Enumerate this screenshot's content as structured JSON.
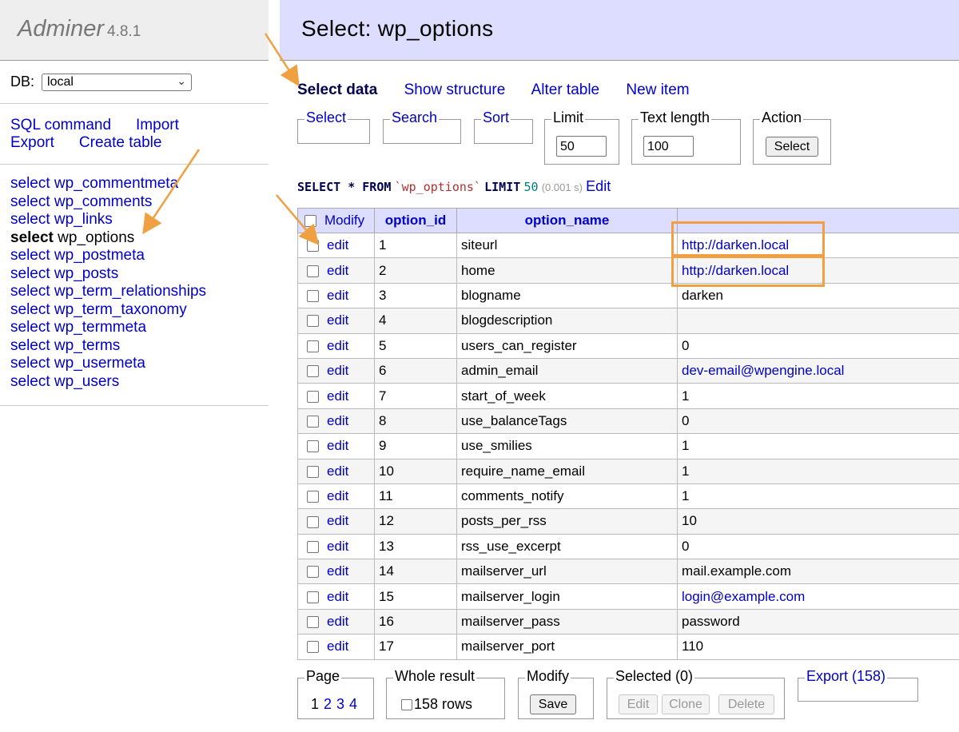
{
  "brand": {
    "name": "Adminer",
    "version": "4.8.1"
  },
  "db": {
    "label": "DB:",
    "value": "local"
  },
  "commands": {
    "sql": "SQL command",
    "import": "Import",
    "export": "Export",
    "create": "Create table"
  },
  "tables": [
    {
      "kw": "select",
      "name": "wp_commentmeta"
    },
    {
      "kw": "select",
      "name": "wp_comments"
    },
    {
      "kw": "select",
      "name": "wp_links"
    },
    {
      "kw": "select",
      "name": "wp_options",
      "active": true
    },
    {
      "kw": "select",
      "name": "wp_postmeta"
    },
    {
      "kw": "select",
      "name": "wp_posts"
    },
    {
      "kw": "select",
      "name": "wp_term_relationships"
    },
    {
      "kw": "select",
      "name": "wp_term_taxonomy"
    },
    {
      "kw": "select",
      "name": "wp_termmeta"
    },
    {
      "kw": "select",
      "name": "wp_terms"
    },
    {
      "kw": "select",
      "name": "wp_usermeta"
    },
    {
      "kw": "select",
      "name": "wp_users"
    }
  ],
  "header": {
    "title": "Select: wp_options"
  },
  "tabs": {
    "select_data": "Select data",
    "show_structure": "Show structure",
    "alter_table": "Alter table",
    "new_item": "New item"
  },
  "filters": {
    "select": "Select",
    "search": "Search",
    "sort": "Sort",
    "limit_label": "Limit",
    "limit_value": "50",
    "textlen_label": "Text length",
    "textlen_value": "100",
    "action_label": "Action",
    "action_button": "Select"
  },
  "query": {
    "part1": "SELECT * FROM",
    "table": "`wp_options`",
    "part2": "LIMIT",
    "limit": "50",
    "time": "(0.001 s)",
    "edit": "Edit"
  },
  "grid": {
    "headers": {
      "modify": "Modify",
      "option_id": "option_id",
      "option_name": "option_name",
      "option_value": ""
    },
    "edit_label": "edit",
    "rows": [
      {
        "id": "1",
        "name": "siteurl",
        "value": "http://darken.local",
        "link": true
      },
      {
        "id": "2",
        "name": "home",
        "value": "http://darken.local",
        "link": true
      },
      {
        "id": "3",
        "name": "blogname",
        "value": "darken"
      },
      {
        "id": "4",
        "name": "blogdescription",
        "value": ""
      },
      {
        "id": "5",
        "name": "users_can_register",
        "value": "0"
      },
      {
        "id": "6",
        "name": "admin_email",
        "value": "dev-email@wpengine.local",
        "link": true
      },
      {
        "id": "7",
        "name": "start_of_week",
        "value": "1"
      },
      {
        "id": "8",
        "name": "use_balanceTags",
        "value": "0"
      },
      {
        "id": "9",
        "name": "use_smilies",
        "value": "1"
      },
      {
        "id": "10",
        "name": "require_name_email",
        "value": "1"
      },
      {
        "id": "11",
        "name": "comments_notify",
        "value": "1"
      },
      {
        "id": "12",
        "name": "posts_per_rss",
        "value": "10"
      },
      {
        "id": "13",
        "name": "rss_use_excerpt",
        "value": "0"
      },
      {
        "id": "14",
        "name": "mailserver_url",
        "value": "mail.example.com"
      },
      {
        "id": "15",
        "name": "mailserver_login",
        "value": "login@example.com",
        "link": true
      },
      {
        "id": "16",
        "name": "mailserver_pass",
        "value": "password"
      },
      {
        "id": "17",
        "name": "mailserver_port",
        "value": "110"
      }
    ]
  },
  "bottom": {
    "page_label": "Page",
    "pages": [
      "1",
      "2",
      "3",
      "4"
    ],
    "whole_label": "Whole result",
    "rows_text": "158 rows",
    "modify_label": "Modify",
    "save": "Save",
    "selected_label": "Selected (0)",
    "edit": "Edit",
    "clone": "Clone",
    "delete": "Delete",
    "export": "Export (158)"
  },
  "colors": {
    "link": "#0000c8",
    "header_bg": "#ddddff",
    "annotation": "#f0a040"
  }
}
